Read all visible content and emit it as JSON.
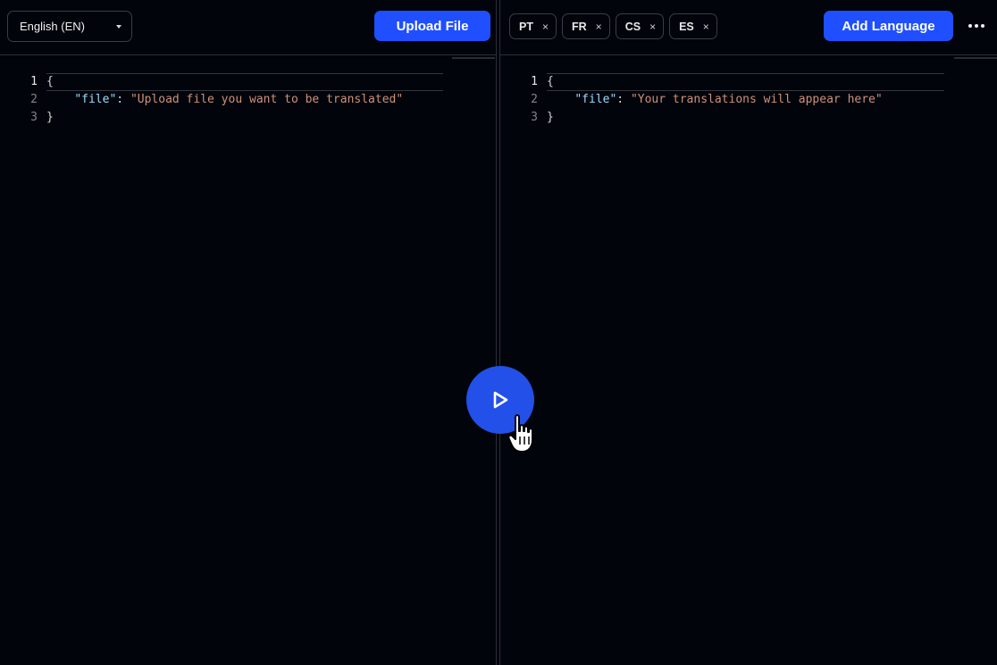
{
  "source": {
    "language_selected": "English (EN)",
    "upload_label": "Upload File",
    "editor_lines": [
      {
        "number": "1",
        "text": "{"
      },
      {
        "number": "2",
        "key": "\"file\"",
        "sep": ": ",
        "value": "\"Upload file you want to be translated\""
      },
      {
        "number": "3",
        "text": "}"
      }
    ]
  },
  "target": {
    "languages": [
      {
        "code": "PT",
        "remove": "×"
      },
      {
        "code": "FR",
        "remove": "×"
      },
      {
        "code": "CS",
        "remove": "×"
      },
      {
        "code": "ES",
        "remove": "×"
      }
    ],
    "add_language_label": "Add Language",
    "editor_lines": [
      {
        "number": "1",
        "text": "{"
      },
      {
        "number": "2",
        "key": "\"file\"",
        "sep": ": ",
        "value": "\"Your translations will appear here\""
      },
      {
        "number": "3",
        "text": "}"
      }
    ]
  },
  "icons": {
    "run": "play-icon",
    "more": "more-horizontal-icon",
    "dropdown": "caret-down-icon",
    "cursor": "hand-pointer-icon"
  },
  "colors": {
    "background": "#02040b",
    "accent": "#1f4fff",
    "run_button": "#2350e8",
    "json_key": "#9cdcfe",
    "json_string": "#ce9178"
  }
}
